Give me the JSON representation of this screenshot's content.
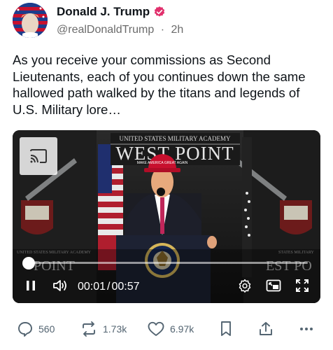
{
  "post": {
    "author_name": "Donald J. Trump",
    "handle": "@realDonaldTrump",
    "separator": "·",
    "time": "2h",
    "text": "As you receive your commissions as Second Lieutenants, each of you continues down the same hallowed path walked by the titans and legends of U.S. Military lore…"
  },
  "video": {
    "banner_top": "UNITED STATES MILITARY ACADEMY",
    "banner_main": "WEST POINT",
    "hat_text": "MAKE AMERICA GREAT AGAIN",
    "side_banner_top": "UNITED STATES MILITARY ACADEMY",
    "side_banner_main": "POINT",
    "current_time": "00:01",
    "duration": "00:57",
    "time_separator": "/",
    "progress": 0.02
  },
  "actions": {
    "replies": "560",
    "reposts": "1.73k",
    "likes": "6.97k"
  },
  "colors": {
    "verified": "#e1306c",
    "text": "#0f1419",
    "muted": "#536471"
  }
}
